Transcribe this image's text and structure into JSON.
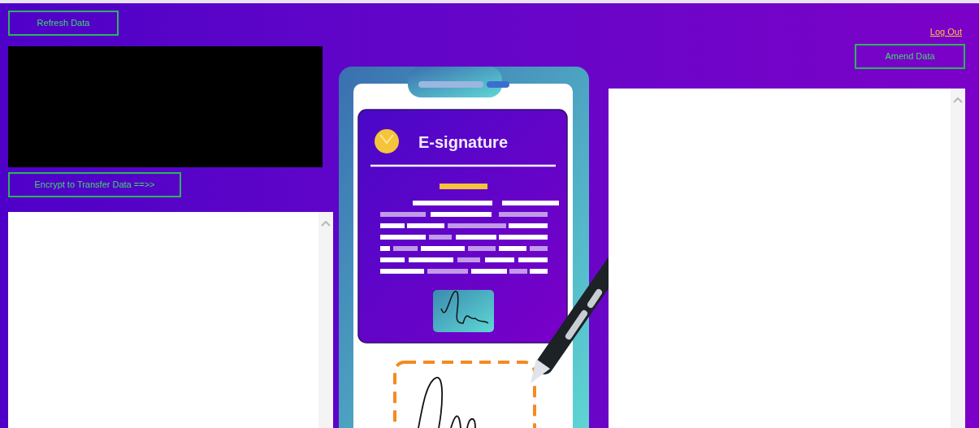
{
  "refresh_button": "Refresh Data",
  "encrypt_button": "Encrypt to Transfer Data ==>>",
  "logout_link": "Log Out",
  "amend_button": "Amend Data",
  "illustration": {
    "title": "E-signature"
  }
}
